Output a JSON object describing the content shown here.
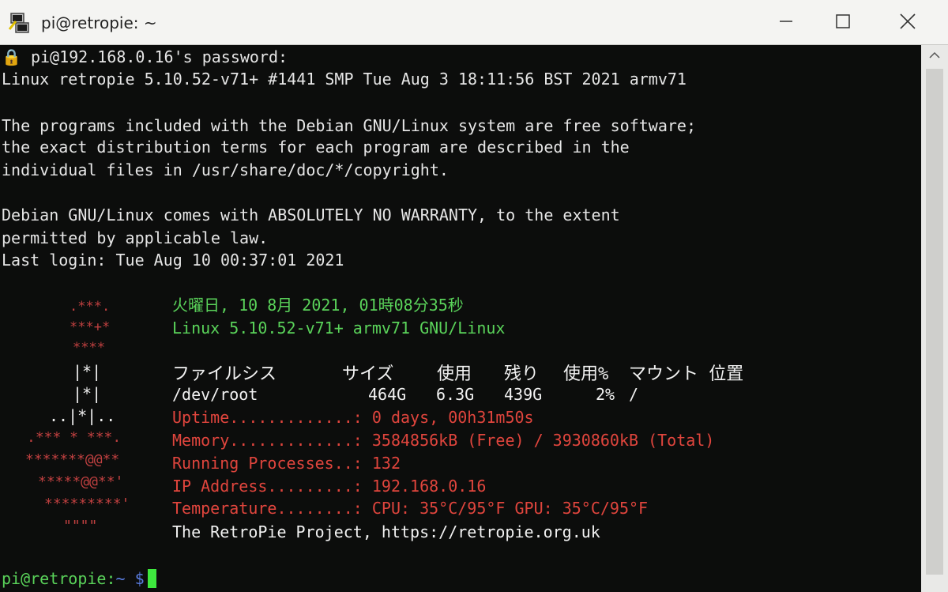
{
  "window": {
    "title": "pi@retropie: ~",
    "icons": [
      "putty-icon",
      "minimize-icon",
      "maximize-icon",
      "close-icon"
    ]
  },
  "terminal": {
    "lines": [
      "pi@192.168.0.16's password:",
      "Linux retropie 5.10.52-v71+ #1441 SMP Tue Aug 3 18:11:56 BST 2021 armv71",
      "The programs included with the Debian GNU/Linux system are free software;",
      "the exact distribution terms for each program are described in the",
      "individual files in /usr/share/doc/*/copyright.",
      "Debian GNU/Linux comes with ABSOLUTELY NO WARRANTY, to the extent",
      "permitted by applicable law.",
      "Last login: Tue Aug 10 00:37:01 2021"
    ],
    "logo_lines": [
      ".***.",
      "***+*",
      "****",
      "|*|",
      "|*|",
      "..|*|..",
      ".*** * ***.",
      "*******@@**",
      "*****@@**'",
      "*********'",
      "\"\"\"\""
    ],
    "datetime": "火曜日, 10 8月 2021, 01時08分35秒",
    "kernel": "Linux 5.10.52-v71+ armv71 GNU/Linux",
    "disk_table": {
      "headers": [
        "ファイルシス",
        "サイズ",
        "使用",
        "残り",
        "使用%",
        "マウント 位置"
      ],
      "row": [
        "/dev/root",
        "464G",
        "6.3G",
        "439G",
        "2%",
        "/"
      ]
    },
    "stats": [
      {
        "label": "Uptime.............:",
        "value": "0 days, 00h31m50s"
      },
      {
        "label": "Memory.............:",
        "value": "3584856kB (Free) / 3930860kB (Total)"
      },
      {
        "label": "Running Processes..:",
        "value": "132"
      },
      {
        "label": "IP Address.........:",
        "value": "192.168.0.16"
      },
      {
        "label": "Temperature........:",
        "value": "CPU: 35°C/95°F GPU: 35°C/95°F"
      }
    ],
    "footer": "The RetroPie Project, https://retropie.org.uk",
    "prompt": {
      "user_host": "pi@retropie:",
      "path": "~",
      "symbol": "$"
    }
  },
  "colors": {
    "terminal_bg": "#0c0d0c",
    "green": "#5ad35a",
    "red": "#e0453d",
    "cursor": "#3ee83e"
  }
}
